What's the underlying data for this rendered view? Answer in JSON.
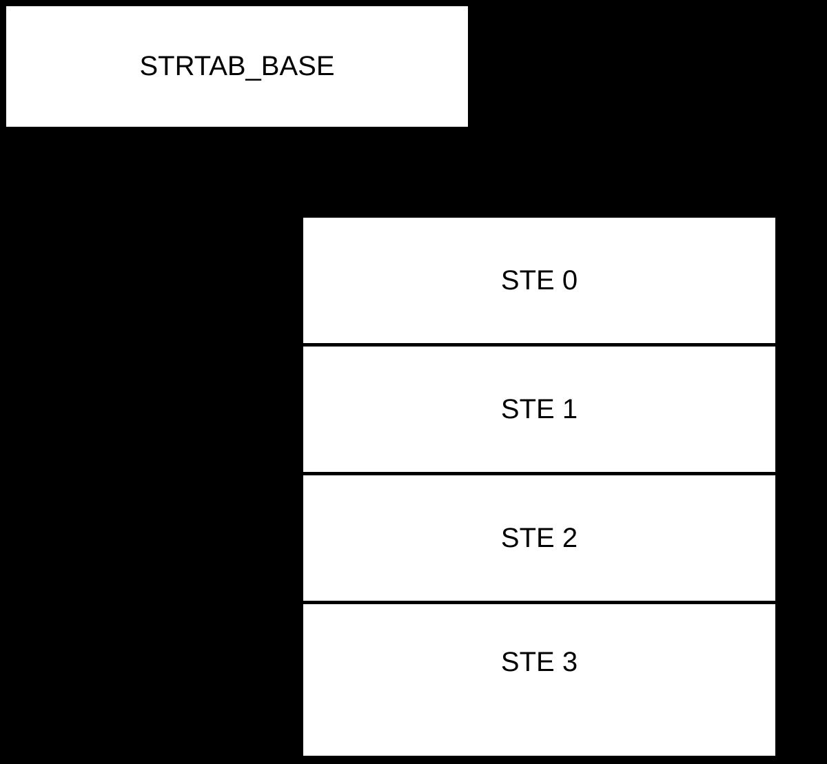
{
  "strtab_base": {
    "label": "STRTAB_BASE"
  },
  "ste_table": {
    "rows": [
      {
        "label": "STE 0"
      },
      {
        "label": "STE 1"
      },
      {
        "label": "STE 2"
      },
      {
        "label": "STE 3"
      }
    ]
  }
}
